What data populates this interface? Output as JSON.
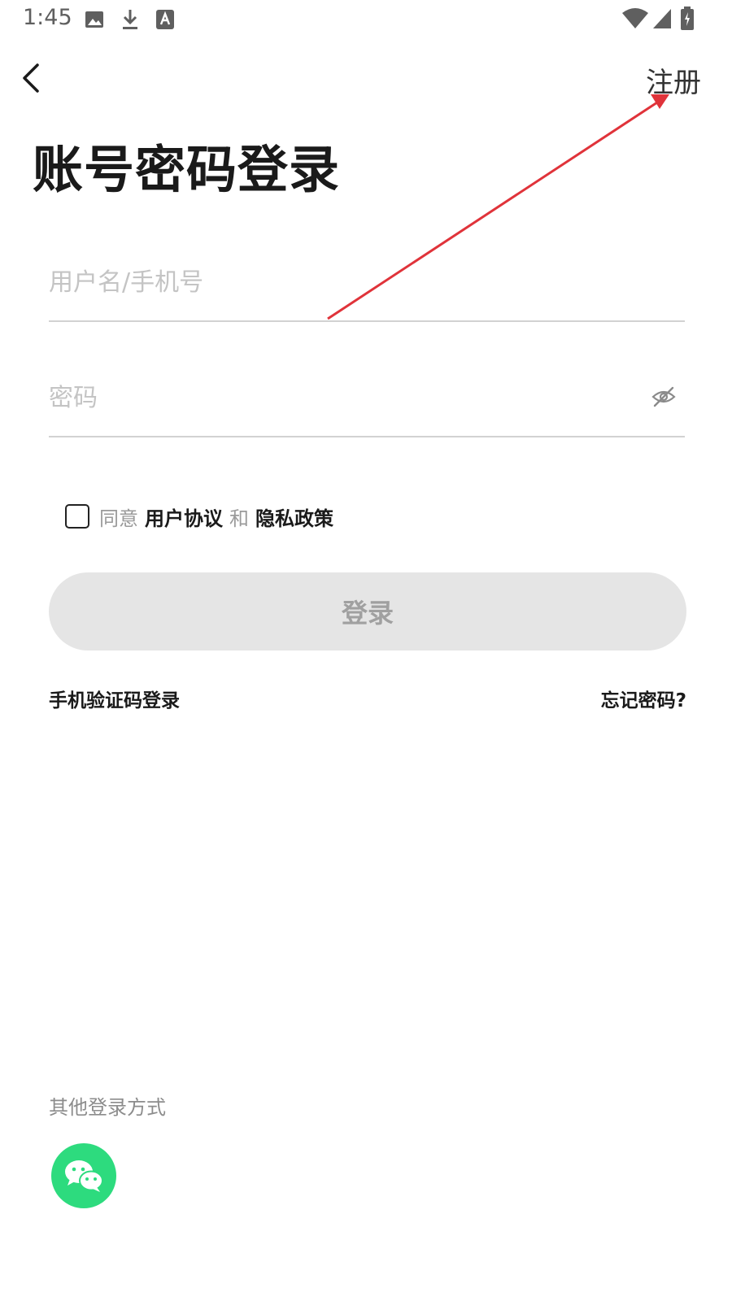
{
  "status_bar": {
    "time": "1:45",
    "left_icons": [
      "image-icon",
      "download-icon",
      "font-icon"
    ],
    "right_icons": [
      "wifi-icon",
      "signal-icon",
      "battery-icon"
    ]
  },
  "header": {
    "back_icon": "chevron-left-icon",
    "register_label": "注册"
  },
  "title": "账号密码登录",
  "form": {
    "username_placeholder": "用户名/手机号",
    "password_placeholder": "密码",
    "password_toggle_icon": "eye-off-icon"
  },
  "agreement": {
    "checked": false,
    "agree_text": "同意",
    "user_agreement": "用户协议",
    "and_text": "和",
    "privacy_policy": "隐私政策"
  },
  "login_button_label": "登录",
  "links": {
    "sms_login": "手机验证码登录",
    "forgot_password": "忘记密码?"
  },
  "other_login": {
    "label": "其他登录方式",
    "wechat_icon": "wechat-icon",
    "wechat_color": "#2ddb7e"
  },
  "colors": {
    "annotation_arrow": "#e0333a",
    "button_bg": "#e5e5e5",
    "placeholder": "#c4c4c4"
  }
}
